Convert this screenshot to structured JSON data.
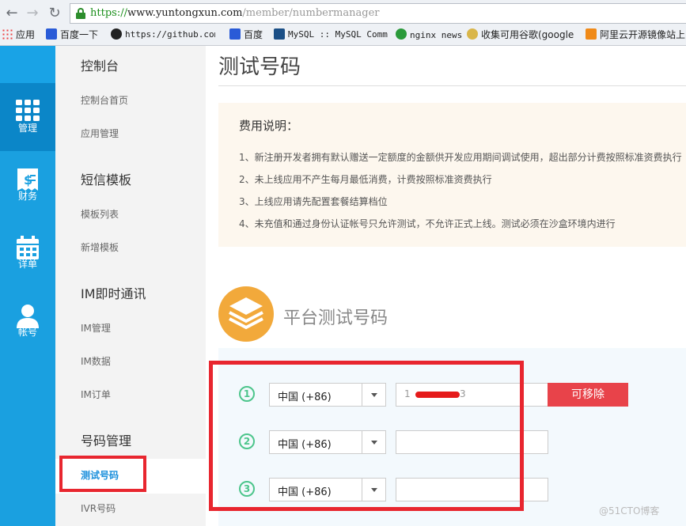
{
  "browser": {
    "url_scheme": "https://",
    "url_host": "www.yuntongxun.com",
    "url_path": "/member/numbermanager",
    "bookmarks": [
      {
        "label": "应用",
        "icon": "apps-grid-icon"
      },
      {
        "label": "百度一下",
        "icon": "baidu-paw-icon"
      },
      {
        "label": "https://github.com/",
        "icon": "github-icon"
      },
      {
        "label": "百度",
        "icon": "baidu-paw-icon"
      },
      {
        "label": "MySQL :: MySQL Comm",
        "icon": "mysql-icon"
      },
      {
        "label": "nginx news",
        "icon": "nginx-icon"
      },
      {
        "label": "收集可用谷歌(google",
        "icon": "globe-icon"
      },
      {
        "label": "阿里云开源镜像站上",
        "icon": "aliyun-icon"
      }
    ]
  },
  "rail": {
    "items": [
      {
        "label": "管理",
        "icon": "grid-icon",
        "active": true
      },
      {
        "label": "财务",
        "icon": "bill-icon"
      },
      {
        "label": "详单",
        "icon": "calendar-icon"
      },
      {
        "label": "帐号",
        "icon": "user-icon"
      }
    ]
  },
  "sidebar": {
    "groups": [
      {
        "title": "控制台",
        "links": [
          "控制台首页",
          "应用管理"
        ]
      },
      {
        "title": "短信模板",
        "links": [
          "模板列表",
          "新增模板"
        ]
      },
      {
        "title": "IM即时通讯",
        "links": [
          "IM管理",
          "IM数据",
          "IM订单"
        ]
      },
      {
        "title": "号码管理",
        "links": [
          "测试号码",
          "IVR号码"
        ]
      }
    ],
    "active_link": "测试号码"
  },
  "main": {
    "title": "测试号码",
    "notice": {
      "title": "费用说明：",
      "lines": [
        "1、新注册开发者拥有默认赠送一定额度的金额供开发应用期间调试使用，超出部分计费按照标准资费执行",
        "2、未上线应用不产生每月最低消费，计费按照标准资费执行",
        "3、上线应用请先配置套餐结算档位",
        "4、未充值和通过身份认证帐号只允许测试，不允许正式上线。测试必须在沙盒环境内进行"
      ]
    },
    "section_title": "平台测试号码",
    "rows": [
      {
        "index": "1",
        "country": "中国 (+86)",
        "phone_prefix": "1",
        "phone_suffix": "3"
      },
      {
        "index": "2",
        "country": "中国 (+86)",
        "phone_prefix": "",
        "phone_suffix": ""
      },
      {
        "index": "3",
        "country": "中国 (+86)",
        "phone_prefix": "",
        "phone_suffix": ""
      }
    ],
    "remove_label": "可移除"
  },
  "watermark": "@51CTO博客"
}
